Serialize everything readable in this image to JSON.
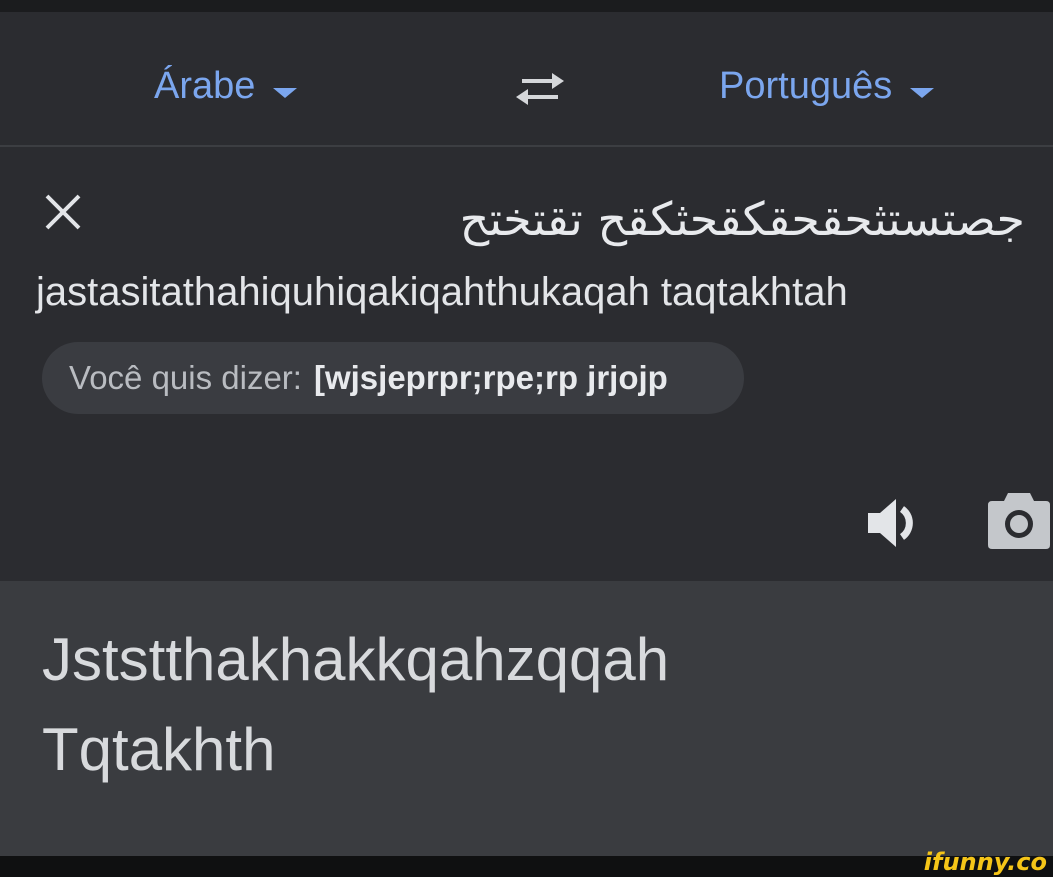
{
  "languages": {
    "source": "Árabe",
    "target": "Português"
  },
  "input": {
    "arabic_text": "جصتستثحقحقكقحثكقح تقتختح",
    "transliteration": "jastasitathahiquhiqakiqahthukaqah taqtakhtah",
    "suggestion_label": "Você quis dizer:",
    "suggestion_value": "[wjsjeprpr;rpe;rp jrjojp"
  },
  "output": {
    "line1": "Jststthakhakkqahzqqah",
    "line2": "Tqtakhth"
  },
  "icons": {
    "swap": "swap-arrows-icon",
    "close": "close-icon",
    "speaker": "speaker-icon",
    "camera": "camera-icon",
    "caret": "caret-down-icon"
  },
  "colors": {
    "accent": "#7ba6ee",
    "background": "#2b2c30",
    "output_background": "#3a3c40",
    "watermark": "#f5c518"
  },
  "watermark": "ifunny.co"
}
